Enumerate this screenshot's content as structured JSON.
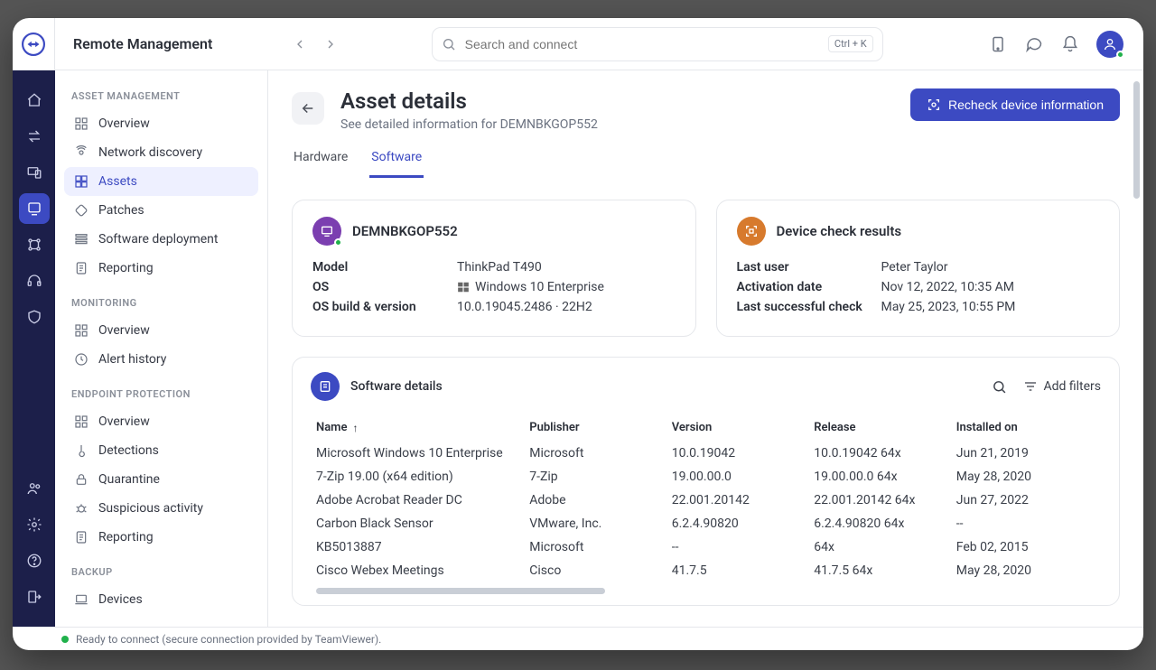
{
  "header": {
    "app_title": "Remote Management",
    "search_placeholder": "Search and connect",
    "search_shortcut": "Ctrl + K"
  },
  "sidebar": {
    "sections": {
      "asset": "ASSET MANAGEMENT",
      "monitoring": "MONITORING",
      "endpoint": "ENDPOINT PROTECTION",
      "backup": "BACKUP"
    },
    "asset": {
      "overview": "Overview",
      "network_discovery": "Network discovery",
      "assets": "Assets",
      "patches": "Patches",
      "software_deployment": "Software deployment",
      "reporting": "Reporting"
    },
    "monitoring": {
      "overview": "Overview",
      "alert_history": "Alert history"
    },
    "endpoint": {
      "overview": "Overview",
      "detections": "Detections",
      "quarantine": "Quarantine",
      "suspicious": "Suspicious activity",
      "reporting": "Reporting"
    },
    "backup": {
      "devices": "Devices"
    }
  },
  "page": {
    "title": "Asset details",
    "subtitle": "See detailed information for DEMNBKGOP552",
    "cta": "Recheck device information"
  },
  "tabs": {
    "hardware": "Hardware",
    "software": "Software"
  },
  "device_card": {
    "name": "DEMNBKGOP552",
    "model_k": "Model",
    "model_v": "ThinkPad T490",
    "os_k": "OS",
    "os_v": "Windows 10 Enterprise",
    "build_k": "OS build & version",
    "build_v": "10.0.19045.2486 · 22H2"
  },
  "check_card": {
    "title": "Device check results",
    "lastuser_k": "Last user",
    "lastuser_v": "Peter Taylor",
    "activation_k": "Activation date",
    "activation_v": "Nov 12, 2022, 10:35 AM",
    "lastcheck_k": "Last successful check",
    "lastcheck_v": "May 25, 2023, 10:55 PM"
  },
  "software": {
    "title": "Software details",
    "add_filters": "Add filters",
    "columns": {
      "name": "Name",
      "publisher": "Publisher",
      "version": "Version",
      "release": "Release",
      "installed": "Installed on"
    },
    "rows": [
      {
        "name": "Microsoft Windows 10 Enterprise",
        "publisher": "Microsoft",
        "version": "10.0.19042",
        "release": "10.0.19042 64x",
        "installed": "Jun 21, 2019"
      },
      {
        "name": "7-Zip 19.00 (x64 edition)",
        "publisher": "7-Zip",
        "version": "19.00.00.0",
        "release": "19.00.00.0 64x",
        "installed": "May 28, 2020"
      },
      {
        "name": "Adobe Acrobat Reader DC",
        "publisher": "Adobe",
        "version": "22.001.20142",
        "release": "22.001.20142 64x",
        "installed": "Jun 27, 2022"
      },
      {
        "name": "Carbon Black Sensor",
        "publisher": "VMware, Inc.",
        "version": "6.2.4.90820",
        "release": "6.2.4.90820 64x",
        "installed": "--"
      },
      {
        "name": "KB5013887",
        "publisher": "Microsoft",
        "version": "--",
        "release": "64x",
        "installed": "Feb 02, 2015"
      },
      {
        "name": "Cisco Webex Meetings",
        "publisher": "Cisco",
        "version": "41.7.5",
        "release": "41.7.5 64x",
        "installed": "May 28, 2020"
      }
    ]
  },
  "statusbar": {
    "text": "Ready to connect (secure connection provided by TeamViewer)."
  }
}
